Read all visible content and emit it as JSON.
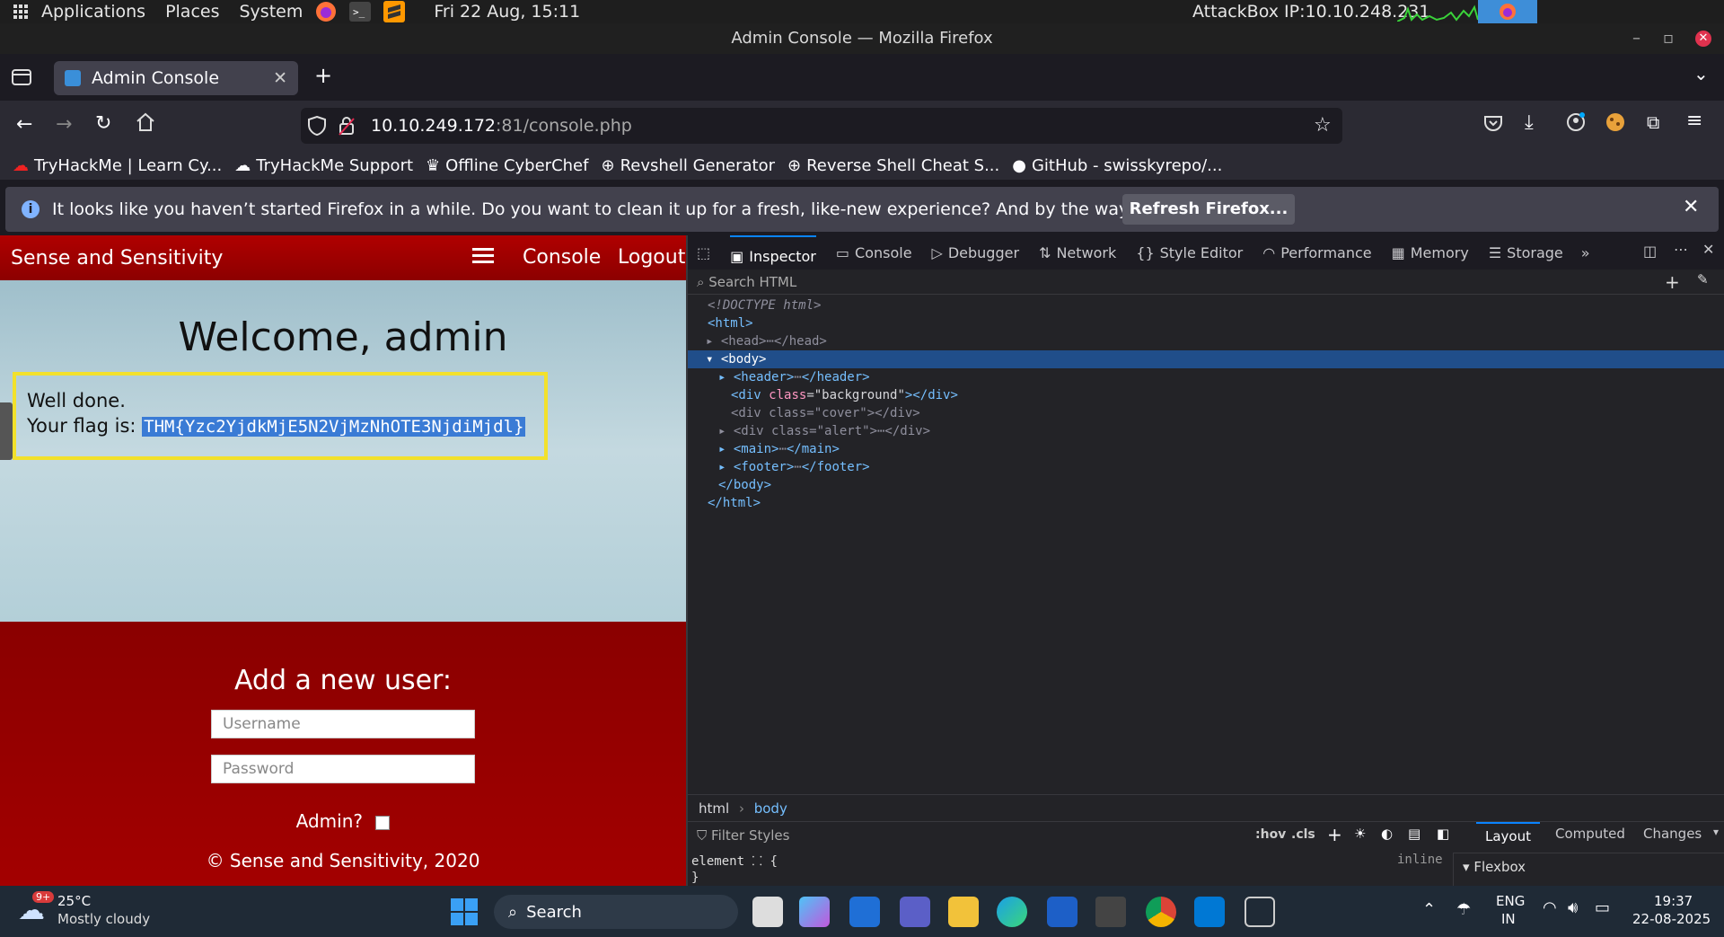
{
  "gnome": {
    "applications": "Applications",
    "places": "Places",
    "system": "System",
    "clock": "Fri 22 Aug, 15:11",
    "attackbox": "AttackBox IP:10.10.248.231"
  },
  "window": {
    "title": "Admin Console — Mozilla Firefox"
  },
  "tab": {
    "label": "Admin Console"
  },
  "url": {
    "host": "10.10.249.172",
    "path": ":81/console.php"
  },
  "bookmarks": [
    "TryHackMe | Learn Cy...",
    "TryHackMe Support",
    "Offline CyberChef",
    "Revshell Generator",
    "Reverse Shell Cheat S...",
    "GitHub - swisskyrepo/..."
  ],
  "notice": {
    "text": "It looks like you haven’t started Firefox in a while. Do you want to clean it up for a fresh, like-new experience? And by the way, welcome back!",
    "button": "Refresh Firefox..."
  },
  "site": {
    "brand": "Sense and Sensitivity",
    "nav_console": "Console",
    "nav_logout": "Logout",
    "welcome": "Welcome, admin",
    "well_done": "Well done.",
    "flag_prefix": "Your flag is: ",
    "flag": "THM{Yzc2YjdkMjE5N2VjMzNhOTE3NjdiMjdl}",
    "add_user_title": "Add a new user:",
    "username_ph": "Username",
    "password_ph": "Password",
    "admin_label": "Admin?",
    "footer": "© Sense and Sensitivity, 2020"
  },
  "devtools": {
    "tabs": [
      "Inspector",
      "Console",
      "Debugger",
      "Network",
      "Style Editor",
      "Performance",
      "Memory",
      "Storage"
    ],
    "search_ph": "Search HTML",
    "crumbs": [
      "html",
      "body"
    ],
    "filter_ph": "Filter Styles",
    "hov": ":hov",
    "cls": ".cls",
    "rule": "element ⸬ {",
    "rule_close": "}",
    "inline": "inline",
    "side_tabs": [
      "Layout",
      "Computed",
      "Changes"
    ],
    "flexbox": "Flexbox"
  },
  "taskbar": {
    "temp": "25°C",
    "weather": "Mostly cloudy",
    "badge": "9+",
    "search": "Search",
    "lang1": "ENG",
    "lang2": "IN",
    "time": "19:37",
    "date": "22-08-2025"
  }
}
